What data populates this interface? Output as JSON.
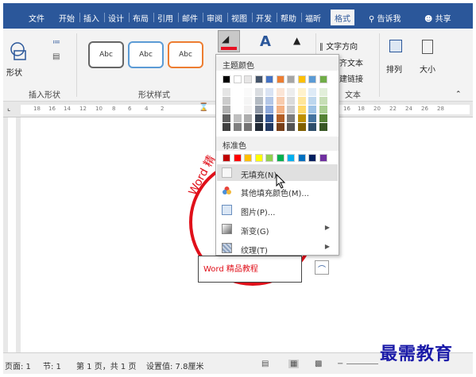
{
  "tabs": [
    "文件",
    "开始",
    "插入",
    "设计",
    "布局",
    "引用",
    "邮件",
    "审阅",
    "视图",
    "开发",
    "帮助",
    "福昕",
    "格式"
  ],
  "active_tab": "格式",
  "tellme": "告诉我",
  "share": "共享",
  "ribbon": {
    "insert_shapes": {
      "label": "插入形状",
      "shape_btn": "形状"
    },
    "shape_styles": {
      "label": "形状样式",
      "styles": [
        "Abc",
        "Abc",
        "Abc"
      ]
    },
    "text_group": {
      "label": "文本",
      "text_direction": "文字方向",
      "align_text": "齐文本",
      "create_link": "建链接"
    },
    "arrange": {
      "label": "排列"
    },
    "size": {
      "label": "大小"
    },
    "wordart_label": "A"
  },
  "ruler_numbers": [
    "18",
    "16",
    "14",
    "12",
    "10",
    "8",
    "6",
    "4",
    "2",
    "16",
    "18",
    "20",
    "22",
    "24",
    "26",
    "28"
  ],
  "dropdown": {
    "theme_colors_label": "主题颜色",
    "standard_colors_label": "标准色",
    "theme_top_row": [
      "#000000",
      "#ffffff",
      "#e7e6e6",
      "#44546a",
      "#4472c4",
      "#ed7d31",
      "#a5a5a5",
      "#ffc000",
      "#5b9bd5",
      "#70ad47"
    ],
    "standard_colors": [
      "#c00000",
      "#ff0000",
      "#ffc000",
      "#ffff00",
      "#92d050",
      "#00b050",
      "#00b0f0",
      "#0070c0",
      "#002060",
      "#7030a0"
    ],
    "items": [
      {
        "label": "无填充(N)",
        "icon": "no-fill-icon"
      },
      {
        "label": "其他填充颜色(M)...",
        "icon": "color-wheel-icon"
      },
      {
        "label": "图片(P)...",
        "icon": "picture-icon"
      },
      {
        "label": "渐变(G)",
        "icon": "gradient-icon"
      },
      {
        "label": "纹理(T)",
        "icon": "texture-icon"
      }
    ]
  },
  "document": {
    "stamp_text": "Word 精",
    "textbox_text": "Word 精品教程"
  },
  "statusbar": {
    "page": "页面: 1",
    "section": "节: 1",
    "pages": "第 1 页，共 1 页",
    "position": "设置值: 7.8厘米"
  },
  "watermark": "最需教育"
}
